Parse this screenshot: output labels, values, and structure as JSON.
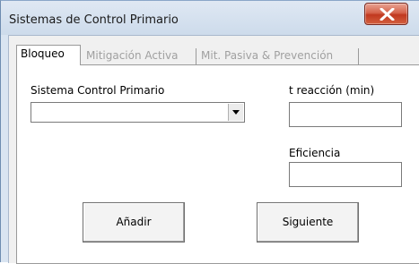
{
  "window": {
    "title": "Sistemas de Control Primario",
    "close_icon": "close-x-icon",
    "colors": {
      "close_button": "#c0381f",
      "titlebar": "#cddbeb"
    }
  },
  "tabs": [
    {
      "label": "Bloqueo",
      "active": true
    },
    {
      "label": "Mitigación Activa",
      "active": false
    },
    {
      "label": "Mit. Pasiva & Prevención",
      "active": false
    }
  ],
  "form": {
    "sistema_label": "Sistema Control Primario",
    "sistema_value": "",
    "treaccion_label": "t reacción (min)",
    "treaccion_value": "",
    "eficiencia_label": "Eficiencia",
    "eficiencia_value": "",
    "dropdown_icon": "chevron-down-icon"
  },
  "buttons": {
    "add_label": "Añadir",
    "next_label": "Siguiente"
  }
}
